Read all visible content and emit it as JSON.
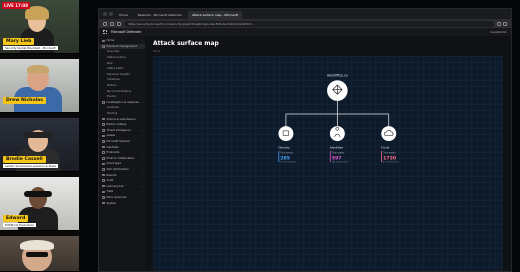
{
  "call": {
    "live_badge": "LIVE 17:08",
    "participants": [
      {
        "name": "Mary Lieb",
        "role": "Security Global Blackbelt - Microsoft"
      },
      {
        "name": "Drew Nicholas",
        "role": ""
      },
      {
        "name": "Brodie Cassell",
        "role": "Latest ransomware sessions & Tasks"
      },
      {
        "name": "Edward",
        "role": "EVP/Body Presidents"
      },
      {
        "name": "",
        "role": ""
      }
    ]
  },
  "browser": {
    "tabs": [
      {
        "label": "Home"
      },
      {
        "label": "Rewards - Microsoft Defender"
      },
      {
        "label": "Attack surface map - Microsoft"
      }
    ],
    "url": "https://security.microsoft.com/security-graph/threatmap/node-3f2b-4e1f-9c0d-2a1b?tid=...",
    "profile": "Guest/Admin"
  },
  "app": {
    "name": "Microsoft Defender",
    "sidebar": [
      {
        "label": "Home",
        "child": false
      },
      {
        "label": "Exposure management",
        "child": false,
        "selected": true
      },
      {
        "label": "Overview",
        "child": true
      },
      {
        "label": "Attack surface",
        "child": true
      },
      {
        "label": "Map",
        "child": true
      },
      {
        "label": "Attack paths",
        "child": true
      },
      {
        "label": "Exposure insights",
        "child": true
      },
      {
        "label": "Initiatives",
        "child": true
      },
      {
        "label": "Metrics",
        "child": true
      },
      {
        "label": "Recommendations",
        "child": true
      },
      {
        "label": "Events",
        "child": true
      },
      {
        "label": "Investigation & response",
        "child": false
      },
      {
        "label": "Incidents",
        "child": true
      },
      {
        "label": "Hunting",
        "child": true
      },
      {
        "label": "Actions & submissions",
        "child": false
      },
      {
        "label": "Partner catalog",
        "child": false
      },
      {
        "label": "Threat intelligence",
        "child": false
      },
      {
        "label": "Assets",
        "child": false
      },
      {
        "label": "Microsoft Sentinel",
        "child": false
      },
      {
        "label": "Identities",
        "child": false
      },
      {
        "label": "Endpoints",
        "child": false
      },
      {
        "label": "Email & collaboration",
        "child": false
      },
      {
        "label": "Cloud apps",
        "child": false
      },
      {
        "label": "SOC optimization",
        "child": false
      },
      {
        "label": "Reports",
        "child": false
      },
      {
        "label": "Audit",
        "child": false
      },
      {
        "label": "Learning hub",
        "child": false
      },
      {
        "label": "Trials",
        "child": false
      },
      {
        "label": "More resources",
        "child": false
      },
      {
        "label": "System",
        "child": false
      }
    ],
    "page_title": "Attack surface map",
    "crumb": "Home",
    "map": {
      "root": {
        "label": "AlexOffice.ca"
      },
      "children": [
        {
          "label": "Devices",
          "total_label": "Total assets",
          "total": "285",
          "critical": "14 critical assets",
          "color": "#4aa3ff",
          "icon": "device-icon"
        },
        {
          "label": "Identities",
          "total_label": "Total assets",
          "total": "597",
          "critical": "145 critical assets",
          "color": "#e05bd6",
          "icon": "identity-icon"
        },
        {
          "label": "Cloud",
          "total_label": "Total assets",
          "total": "1730",
          "critical": "41 critical assets",
          "color": "#ff6b8a",
          "icon": "cloud-icon"
        }
      ]
    }
  }
}
